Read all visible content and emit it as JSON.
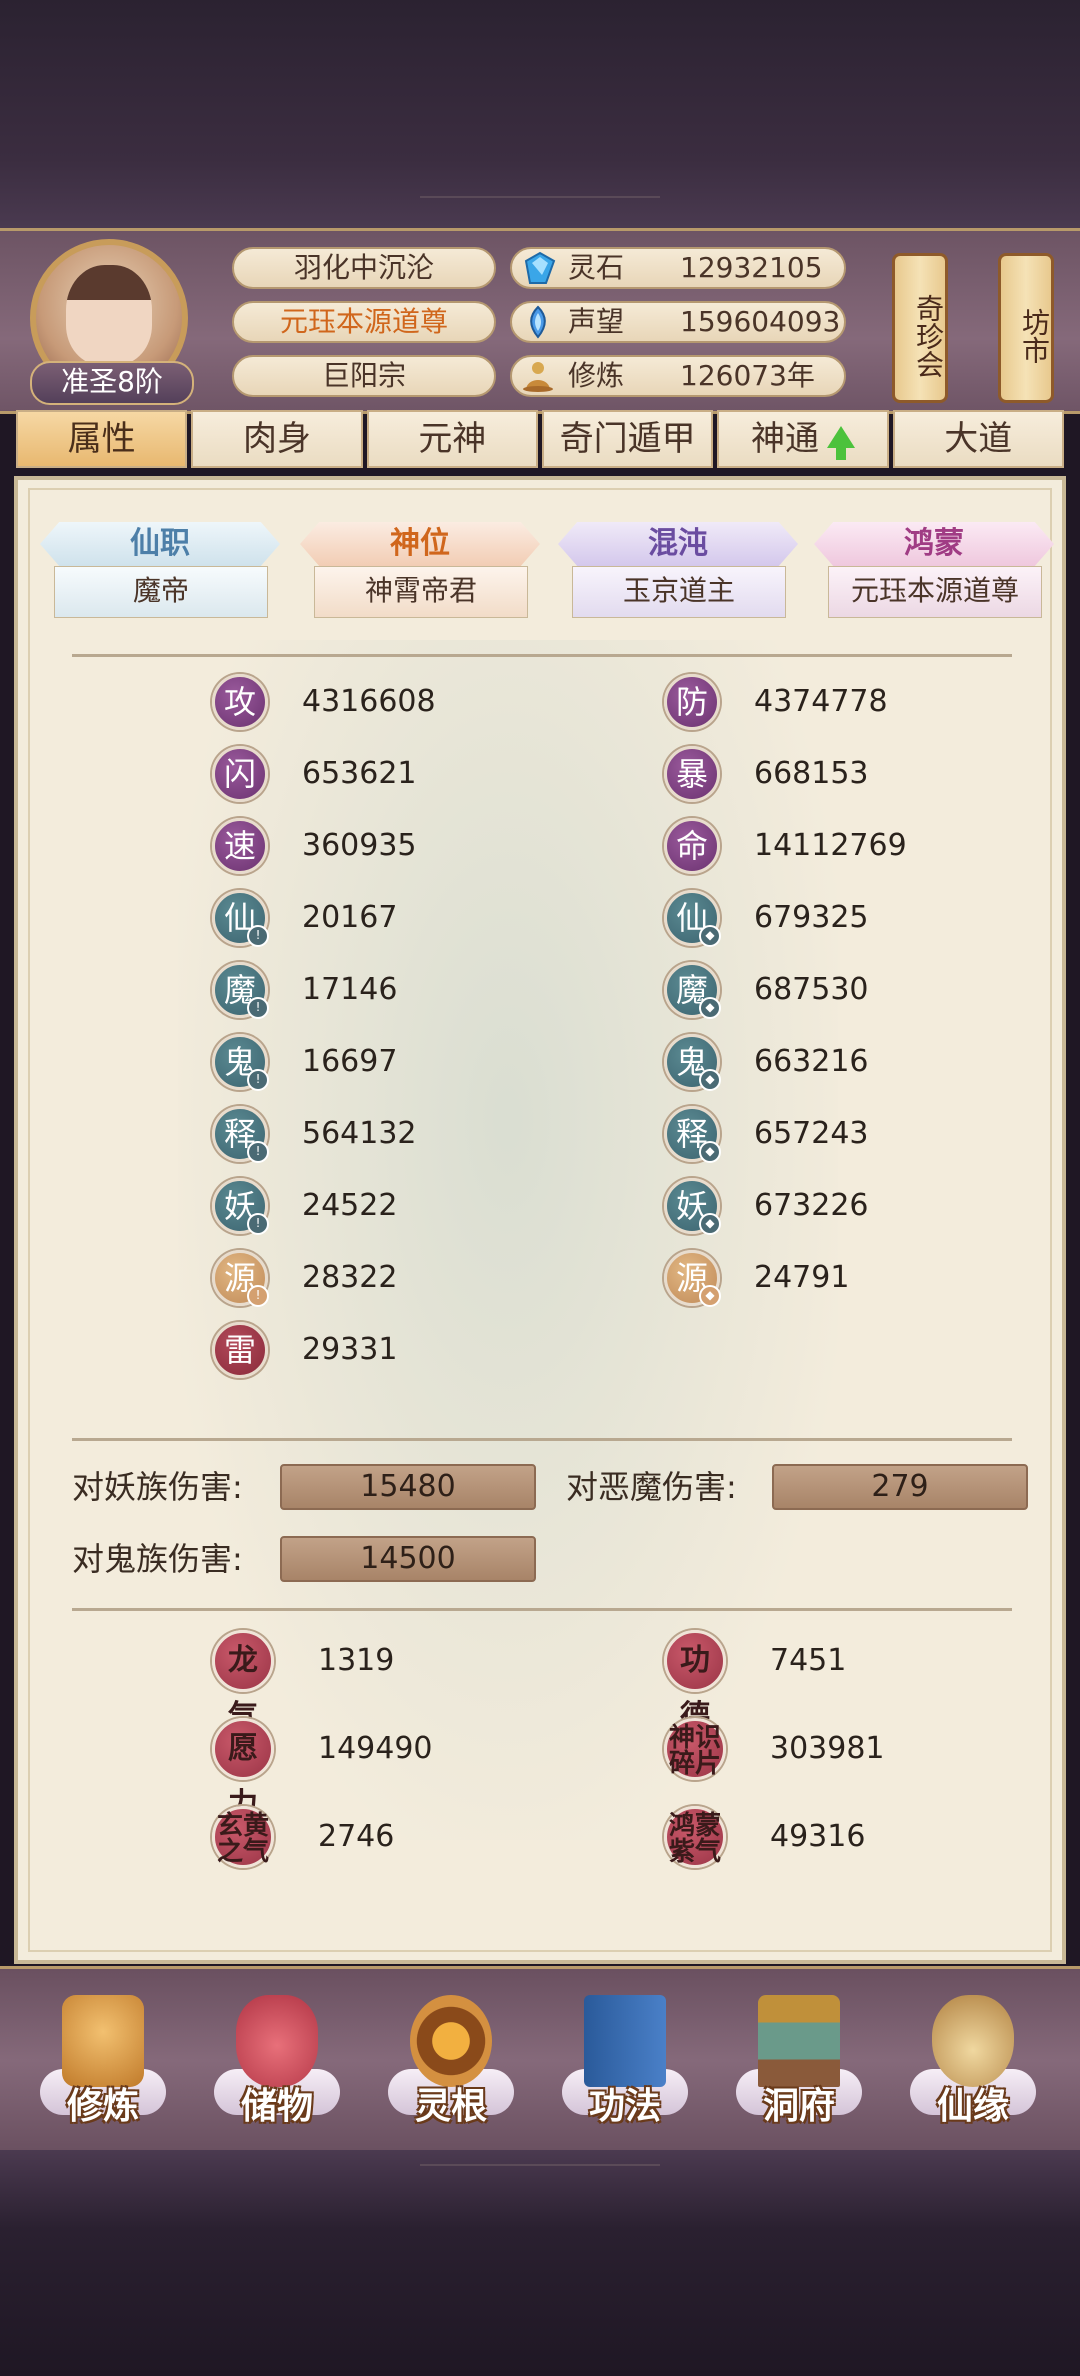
{
  "header": {
    "rank": "准圣8阶",
    "realm": "羽化中沉沦",
    "title": "元珏本源道尊",
    "sect": "巨阳宗",
    "resources": [
      {
        "icon": "spirit-stone-icon",
        "label": "灵石",
        "value": "12932105"
      },
      {
        "icon": "reputation-icon",
        "label": "声望",
        "value": "159604093"
      },
      {
        "icon": "cultivation-icon",
        "label": "修炼",
        "value": "126073年"
      }
    ],
    "shortcuts": [
      "奇珍会",
      "坊市"
    ]
  },
  "tabs": [
    "属性",
    "肉身",
    "元神",
    "奇门遁甲",
    "神通",
    "大道"
  ],
  "ranks": [
    {
      "title": "仙职",
      "value": "魔帝"
    },
    {
      "title": "神位",
      "value": "神霄帝君"
    },
    {
      "title": "混沌",
      "value": "玉京道主"
    },
    {
      "title": "鸿蒙",
      "value": "元珏本源道尊"
    }
  ],
  "stats_left": [
    {
      "char": "攻",
      "value": "4316608"
    },
    {
      "char": "闪",
      "value": "653621"
    },
    {
      "char": "速",
      "value": "360935"
    },
    {
      "char": "仙",
      "value": "20167"
    },
    {
      "char": "魔",
      "value": "17146"
    },
    {
      "char": "鬼",
      "value": "16697"
    },
    {
      "char": "释",
      "value": "564132"
    },
    {
      "char": "妖",
      "value": "24522"
    },
    {
      "char": "源",
      "value": "28322"
    },
    {
      "char": "雷",
      "value": "29331"
    }
  ],
  "stats_right": [
    {
      "char": "防",
      "value": "4374778"
    },
    {
      "char": "暴",
      "value": "668153"
    },
    {
      "char": "命",
      "value": "14112769"
    },
    {
      "char": "仙",
      "value": "679325"
    },
    {
      "char": "魔",
      "value": "687530"
    },
    {
      "char": "鬼",
      "value": "663216"
    },
    {
      "char": "释",
      "value": "657243"
    },
    {
      "char": "妖",
      "value": "673226"
    },
    {
      "char": "源",
      "value": "24791"
    }
  ],
  "damage": [
    {
      "label": "对妖族伤害:",
      "value": "15480"
    },
    {
      "label": "对恶魔伤害:",
      "value": "279"
    },
    {
      "label": "对鬼族伤害:",
      "value": "14500"
    }
  ],
  "misc": [
    {
      "label": "龙气",
      "value": "1319"
    },
    {
      "label": "功德",
      "value": "7451"
    },
    {
      "label": "愿力",
      "value": "149490"
    },
    {
      "label": "神识碎片",
      "value": "303981"
    },
    {
      "label": "玄黄之气",
      "value": "2746"
    },
    {
      "label": "鸿蒙紫气",
      "value": "49316"
    }
  ],
  "nav": [
    {
      "label": "修炼",
      "icon": "cultivate-icon"
    },
    {
      "label": "储物",
      "icon": "storage-bag-icon"
    },
    {
      "label": "灵根",
      "icon": "spirit-root-icon"
    },
    {
      "label": "功法",
      "icon": "technique-book-icon"
    },
    {
      "label": "洞府",
      "icon": "cave-dwelling-icon"
    },
    {
      "label": "仙缘",
      "icon": "immortal-fate-icon"
    }
  ]
}
